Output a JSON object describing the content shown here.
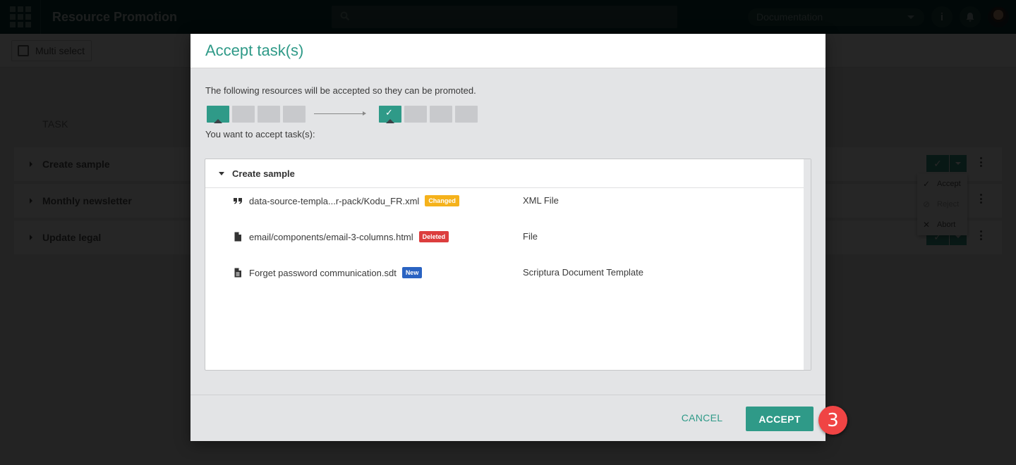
{
  "app": {
    "title": "Resource Promotion",
    "search_placeholder": "",
    "project_selector": "Documentation",
    "info_label": "i"
  },
  "toolbar": {
    "multi_select_label": "Multi select"
  },
  "task_list": {
    "column_header": "TASK",
    "tasks": [
      {
        "label": "Create sample"
      },
      {
        "label": "Monthly newsletter"
      },
      {
        "label": "Update legal"
      }
    ],
    "action_menu": [
      {
        "label": "Accept",
        "icon": "check-icon",
        "enabled": true
      },
      {
        "label": "Reject",
        "icon": "ban-icon",
        "enabled": false
      },
      {
        "label": "Abort",
        "icon": "close-icon",
        "enabled": true
      }
    ]
  },
  "modal": {
    "title": "Accept task(s)",
    "intro": "The following resources will be accepted so they can be promoted.",
    "environments": {
      "source_count": 4,
      "source_active_index": 0,
      "target_count": 4,
      "target_active_index": 0
    },
    "prompt": "You want to accept task(s):",
    "group": {
      "label": "Create sample",
      "resources": [
        {
          "name": "data-source-templa...r-pack/Kodu_FR.xml",
          "icon": "quote-icon",
          "status": "Changed",
          "status_color": "#f5b21b",
          "type": "XML File"
        },
        {
          "name": "email/components/email-3-columns.html",
          "icon": "file-icon",
          "status": "Deleted",
          "status_color": "#dc3d3d",
          "type": "File"
        },
        {
          "name": "Forget password communication.sdt",
          "icon": "document-icon",
          "status": "New",
          "status_color": "#2a63c2",
          "type": "Scriptura Document Template"
        }
      ]
    },
    "cancel_label": "CANCEL",
    "accept_label": "ACCEPT"
  },
  "annotation": {
    "step_number": "3"
  },
  "colors": {
    "accent": "#2f9a88",
    "topbar": "#0d3b38"
  }
}
